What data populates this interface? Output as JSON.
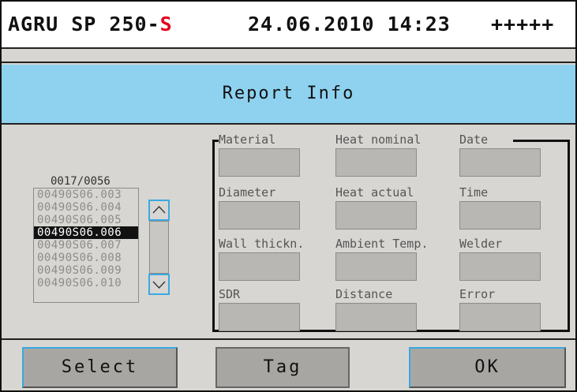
{
  "header": {
    "title_prefix": "AGRU SP 250-",
    "title_suffix": "S",
    "datetime": "24.06.2010 14:23",
    "signal": "+++++"
  },
  "titlebar": {
    "title": "Report Info"
  },
  "list": {
    "counter": "0017/0056",
    "items": [
      "00490S06.003",
      "00490S06.004",
      "00490S06.005",
      "00490S06.006",
      "00490S06.007",
      "00490S06.008",
      "00490S06.009",
      "00490S06.010"
    ],
    "selected_index": 3
  },
  "fields": [
    {
      "label": "Material",
      "value": ""
    },
    {
      "label": "Heat nominal",
      "value": ""
    },
    {
      "label": "Date",
      "value": ""
    },
    {
      "label": "Diameter",
      "value": ""
    },
    {
      "label": "Heat actual",
      "value": ""
    },
    {
      "label": "Time",
      "value": ""
    },
    {
      "label": "Wall thickn.",
      "value": ""
    },
    {
      "label": "Ambient Temp.",
      "value": ""
    },
    {
      "label": "Welder",
      "value": ""
    },
    {
      "label": "SDR",
      "value": ""
    },
    {
      "label": "Distance",
      "value": ""
    },
    {
      "label": "Error",
      "value": ""
    }
  ],
  "buttons": {
    "select": "Select",
    "tag": "Tag",
    "ok": "OK"
  },
  "colors": {
    "accent": "#e3001b",
    "titlebar": "#8fd2f0",
    "button_highlight": "#3aa9e0"
  },
  "icons": {
    "scroll_up": "chevron-up-icon",
    "scroll_down": "chevron-down-icon"
  }
}
